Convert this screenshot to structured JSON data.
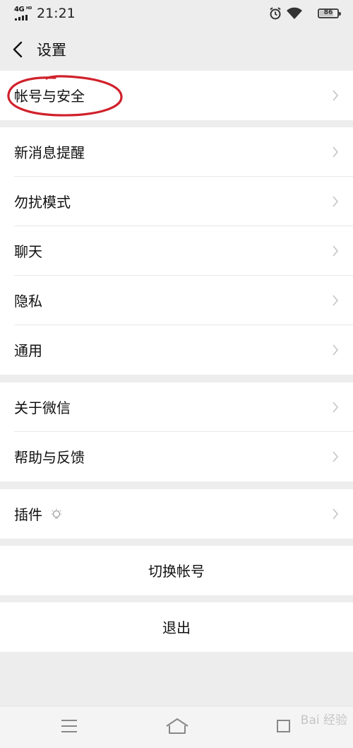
{
  "status_bar": {
    "network": "4G",
    "network_hd": "HD",
    "time": "21:21",
    "alarm_icon": "alarm-icon",
    "wifi_icon": "wifi-icon",
    "battery_level": "86"
  },
  "nav": {
    "back_icon": "chevron-left-icon",
    "title": "设置"
  },
  "groups": [
    {
      "items": [
        {
          "label": "帐号与安全",
          "chevron": true
        }
      ]
    },
    {
      "items": [
        {
          "label": "新消息提醒",
          "chevron": true
        },
        {
          "label": "勿扰模式",
          "chevron": true
        },
        {
          "label": "聊天",
          "chevron": true
        },
        {
          "label": "隐私",
          "chevron": true
        },
        {
          "label": "通用",
          "chevron": true
        }
      ]
    },
    {
      "items": [
        {
          "label": "关于微信",
          "chevron": true
        },
        {
          "label": "帮助与反馈",
          "chevron": true
        }
      ]
    },
    {
      "items": [
        {
          "label": "插件",
          "chevron": true,
          "icon": "plugin-bulb-icon"
        }
      ]
    }
  ],
  "actions": {
    "switch_account": "切换帐号",
    "logout": "退出"
  },
  "annotation": {
    "color": "#d0212b",
    "target": "帐号与安全"
  },
  "bottom_nav": {
    "menu_icon": "menu-icon",
    "home_icon": "home-icon",
    "back_icon": "recent-icon"
  },
  "watermark": "Bai 经验",
  "colors": {
    "background": "#ededed",
    "cell": "#ffffff",
    "text": "#111111",
    "chevron": "#c4c4c4"
  }
}
